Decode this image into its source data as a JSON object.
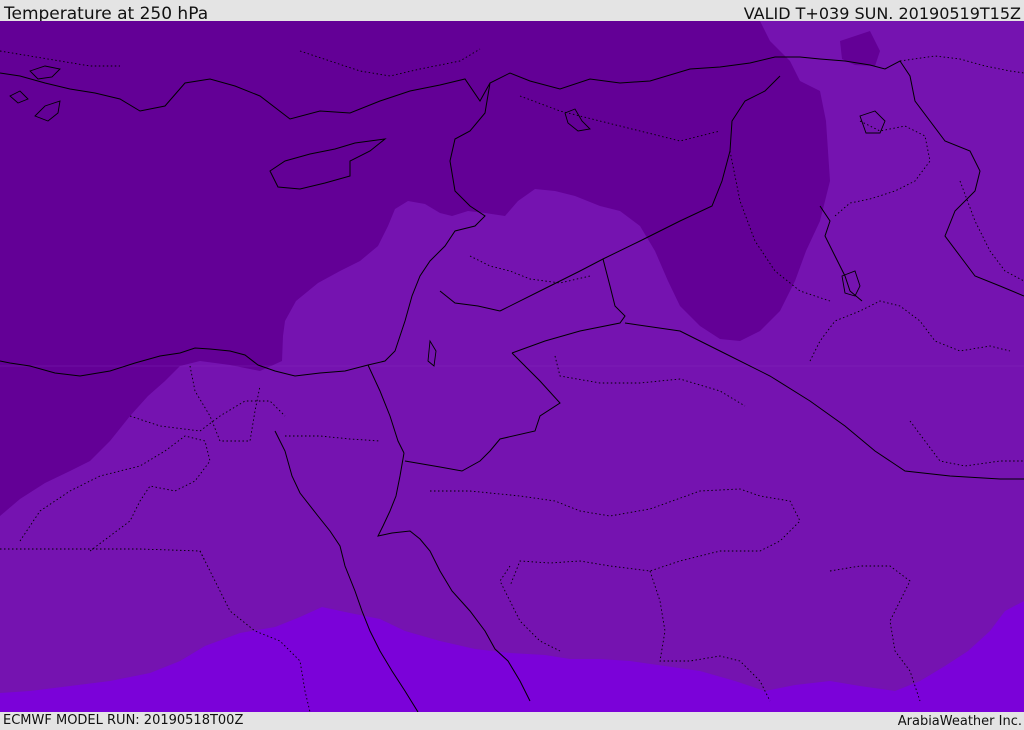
{
  "header": {
    "title": "Temperature at 250 hPa",
    "valid_time": "VALID T+039 SUN. 20190519T15Z"
  },
  "footer": {
    "model_run": "ECMWF MODEL RUN: 20190518T00Z",
    "credit": "ArabiaWeather Inc."
  },
  "map": {
    "field": "Temperature at 250 hPa",
    "region": "Eastern Mediterranean / Middle East",
    "colors": {
      "coldest_band": "#630096",
      "middle_band": "#7513b0",
      "warmest_band": "#7b02d9",
      "borders": "#000000"
    }
  }
}
